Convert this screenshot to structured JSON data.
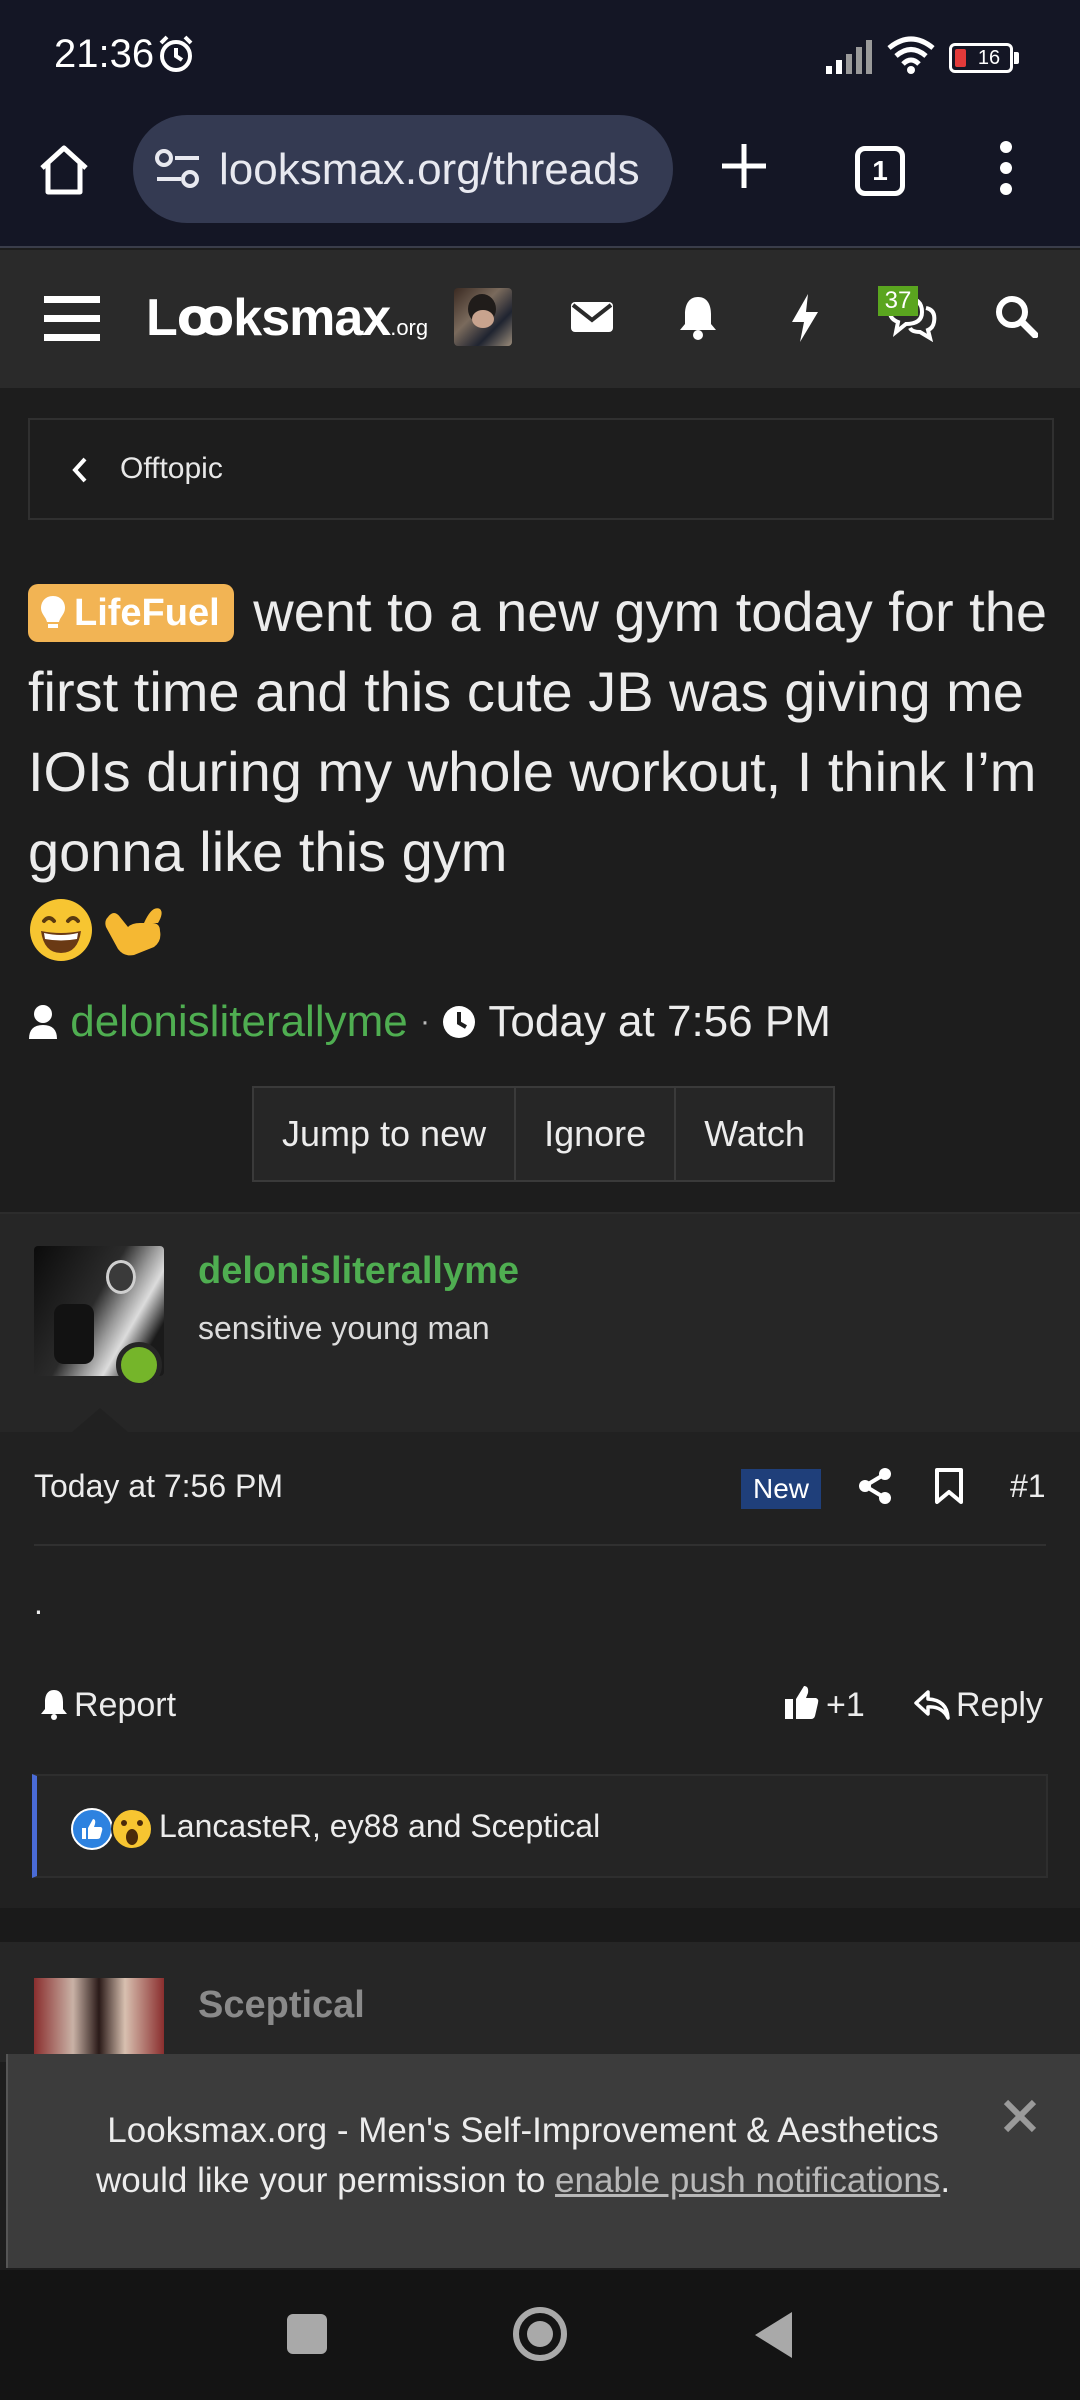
{
  "status_bar": {
    "time": "21:36",
    "battery": "16"
  },
  "browser": {
    "url": "looksmax.org/threads",
    "tab_count": "1"
  },
  "site": {
    "logo_main": "Lꝏksmax",
    "logo_suffix": ".org",
    "notification_badge": "37"
  },
  "breadcrumb": {
    "label": "Offtopic"
  },
  "thread": {
    "prefix": "LifeFuel",
    "title": "went to a new gym today for the first time and this cute JB was giving me IOIs during my whole workout, I think I’m gonna like this gym",
    "emoji": "😄🤙",
    "author": "delonisliterallyme",
    "separator": "·",
    "time": "Today at 7:56 PM",
    "buttons": [
      "Jump to new",
      "Ignore",
      "Watch"
    ]
  },
  "post": {
    "username": "delonisliterallyme",
    "user_title": "sensitive young man",
    "date": "Today at 7:56 PM",
    "badge": "New",
    "number": "#1",
    "content": ".",
    "report_label": "Report",
    "like_label": "+1",
    "reply_label": "Reply",
    "reactions_text": "LancasteR, ey88 and Sceptical"
  },
  "next_post": {
    "username": "Sceptical"
  },
  "push_notice": {
    "line1": "Looksmax.org - Men's Self-Improvement & Aesthetics",
    "line2_prefix": "would like your permission to ",
    "link": "enable push notifications",
    "line2_suffix": "."
  },
  "colors": {
    "accent_green": "#4fae51",
    "prefix_orange": "#f2b454",
    "new_badge": "#1f3f7a",
    "browser_bg": "#141625"
  }
}
